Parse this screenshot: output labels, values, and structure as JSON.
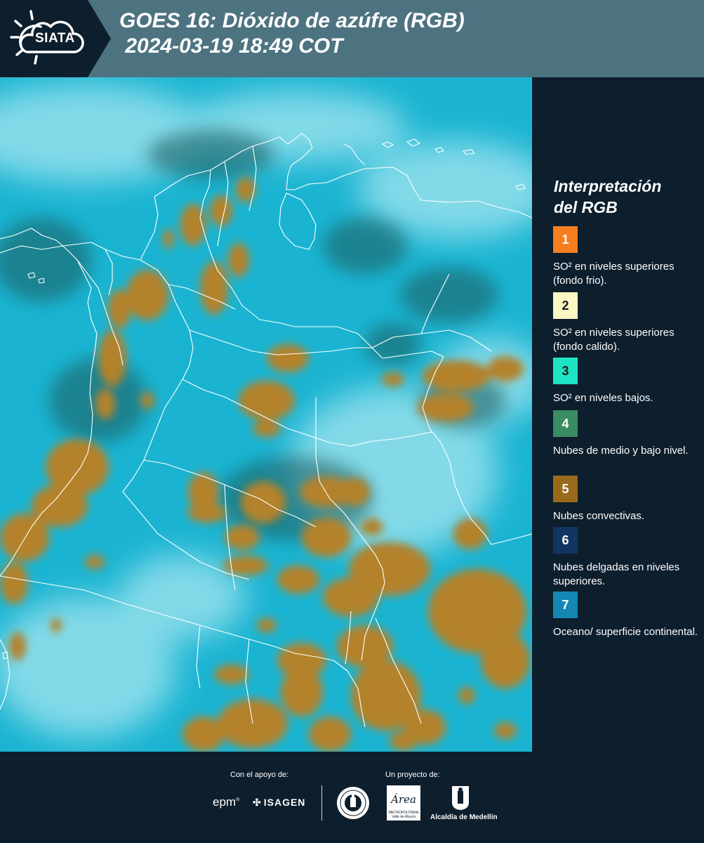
{
  "header": {
    "logo_text": "SIATA",
    "title": "GOES 16: Dióxido de azúfre (RGB)\n 2024-03-19 18:49 COT"
  },
  "legend": {
    "title": "Interpretación\ndel RGB",
    "items": [
      {
        "number": "1",
        "label": "SO² en niveles superiores (fondo frio).",
        "color": "#f57e20",
        "text_color": "#ffffff"
      },
      {
        "number": "2",
        "label": "SO² en niveles superiores (fondo calido).",
        "color": "#fdf7c4",
        "text_color": "#1a1a1a"
      },
      {
        "number": "3",
        "label": "SO² en niveles bajos.",
        "color": "#1ee3c4",
        "text_color": "#1a1a1a"
      },
      {
        "number": "4",
        "label": "Nubes de medio y bajo nivel.",
        "color": "#3a8c62",
        "text_color": "#ffffff"
      },
      {
        "number": "5",
        "label": "Nubes convectivas.",
        "color": "#9a6a1c",
        "text_color": "#ffffff"
      },
      {
        "number": "6",
        "label": "Nubes delgadas en niveles superiores.",
        "color": "#123463",
        "text_color": "#ffffff"
      },
      {
        "number": "7",
        "label": "Oceano/ superficie continental.",
        "color": "#1487b5",
        "text_color": "#ffffff"
      }
    ]
  },
  "map": {
    "background_color": "#1ab4d2",
    "cloud_color": "#b4822c",
    "border_color": "#ffffff"
  },
  "footer": {
    "support_label": "Con el apoyo de:",
    "project_label": "Un proyecto de:",
    "epm": "epm",
    "isagen": "ISAGEN",
    "area_logo": "Área",
    "area_sub": "METROPOLITANA Valle de Aburrá",
    "alcaldia": "Alcaldía de Medellín"
  }
}
